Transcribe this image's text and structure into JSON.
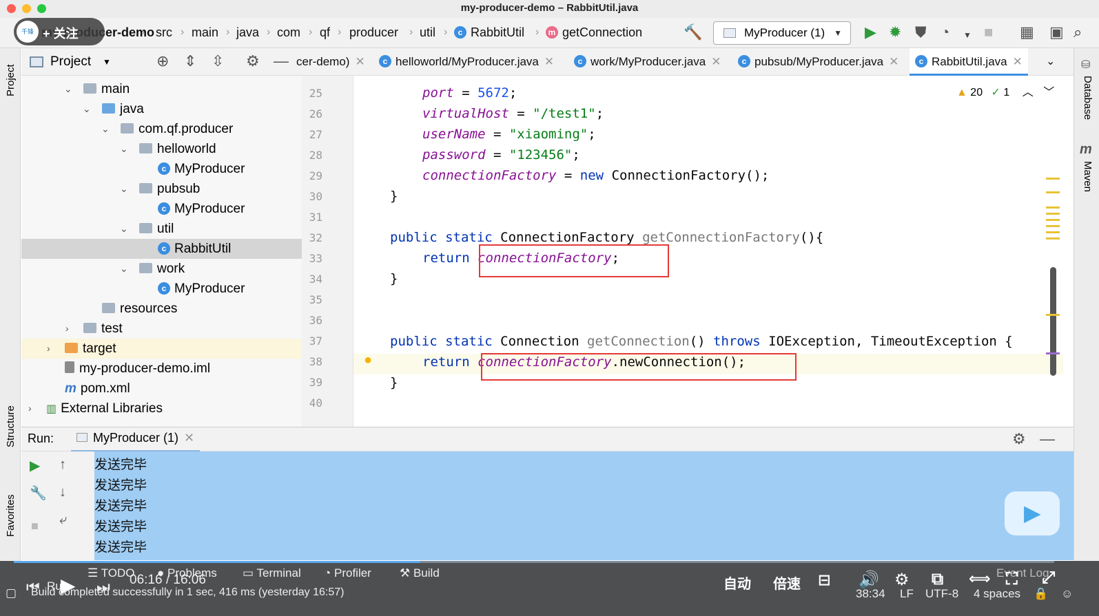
{
  "window": {
    "title": "my-producer-demo – RabbitUtil.java"
  },
  "navbar": {
    "crumbs": [
      "my-producer-demo",
      "src",
      "main",
      "java",
      "com",
      "qf",
      "producer",
      "util",
      "RabbitUtil",
      "getConnection"
    ],
    "run_config": "MyProducer (1)"
  },
  "overlay": {
    "follow": "+ 关注"
  },
  "project": {
    "header": "Project",
    "tree": [
      {
        "label": "main"
      },
      {
        "label": "java"
      },
      {
        "label": "com.qf.producer"
      },
      {
        "label": "helloworld"
      },
      {
        "label": "MyProducer"
      },
      {
        "label": "pubsub"
      },
      {
        "label": "MyProducer"
      },
      {
        "label": "util"
      },
      {
        "label": "RabbitUtil"
      },
      {
        "label": "work"
      },
      {
        "label": "MyProducer"
      },
      {
        "label": "resources"
      },
      {
        "label": "test"
      },
      {
        "label": "target"
      },
      {
        "label": "my-producer-demo.iml"
      },
      {
        "label": "pom.xml"
      },
      {
        "label": "External Libraries"
      }
    ]
  },
  "side": {
    "project": "Project",
    "structure": "Structure",
    "favorites": "Favorites",
    "database": "Database",
    "maven": "Maven"
  },
  "tabs": [
    {
      "label": "cer-demo)"
    },
    {
      "label": "helloworld/MyProducer.java"
    },
    {
      "label": "work/MyProducer.java"
    },
    {
      "label": "pubsub/MyProducer.java"
    },
    {
      "label": "RabbitUtil.java"
    }
  ],
  "inspections": {
    "warnings": "20",
    "checks": "1"
  },
  "code": {
    "line_numbers": [
      "25",
      "26",
      "27",
      "28",
      "29",
      "30",
      "31",
      "32",
      "33",
      "34",
      "35",
      "36",
      "37",
      "38",
      "39",
      "40"
    ],
    "l25": {
      "field": "port",
      "eq": " = ",
      "num": "5672",
      "end": ";"
    },
    "l26": {
      "field": "virtualHost",
      "eq": " = ",
      "str": "\"/test1\"",
      "end": ";"
    },
    "l27": {
      "field": "userName",
      "eq": " = ",
      "str": "\"xiaoming\"",
      "end": ";"
    },
    "l28": {
      "field": "password",
      "eq": " = ",
      "str": "\"123456\"",
      "end": ";"
    },
    "l29": {
      "field": "connectionFactory",
      "eq": " = ",
      "kw": "new",
      "rest": " ConnectionFactory();"
    },
    "l30": "}",
    "l32": {
      "kw": "public static",
      "type": " ConnectionFactory ",
      "method": "getConnectionFactory",
      "rest": "(){"
    },
    "l33": {
      "kw": "return",
      "field": "connectionFactory",
      "end": ";"
    },
    "l34": "}",
    "l37": {
      "kw": "public static",
      "type": " Connection ",
      "method": "getConnection",
      "rest1": "() ",
      "kw2": "throws",
      "rest2": " IOException, TimeoutException {"
    },
    "l38": {
      "kw": "return",
      "field": "connectionFactory",
      "rest": ".newConnection();"
    },
    "l39": "}"
  },
  "run": {
    "label": "Run:",
    "tab": "MyProducer (1)",
    "output": [
      "发送完毕",
      "发送完毕",
      "发送完毕",
      "发送完毕",
      "发送完毕"
    ]
  },
  "bottom_tabs": {
    "run": "Ru",
    "todo": "TODO",
    "problems": "Problems",
    "terminal": "Terminal",
    "profiler": "Profiler",
    "build": "Build"
  },
  "status": {
    "message": "Build completed successfully in 1 sec, 416 ms (yesterday 16:57)",
    "position": "38:34",
    "line_sep": "LF",
    "encoding": "UTF-8",
    "indent": "4 spaces",
    "event_log": "Event Log"
  },
  "player": {
    "time": "06:16 / 16:06",
    "auto": "自动",
    "speed": "倍速",
    "progress_fraction": 0.39
  }
}
